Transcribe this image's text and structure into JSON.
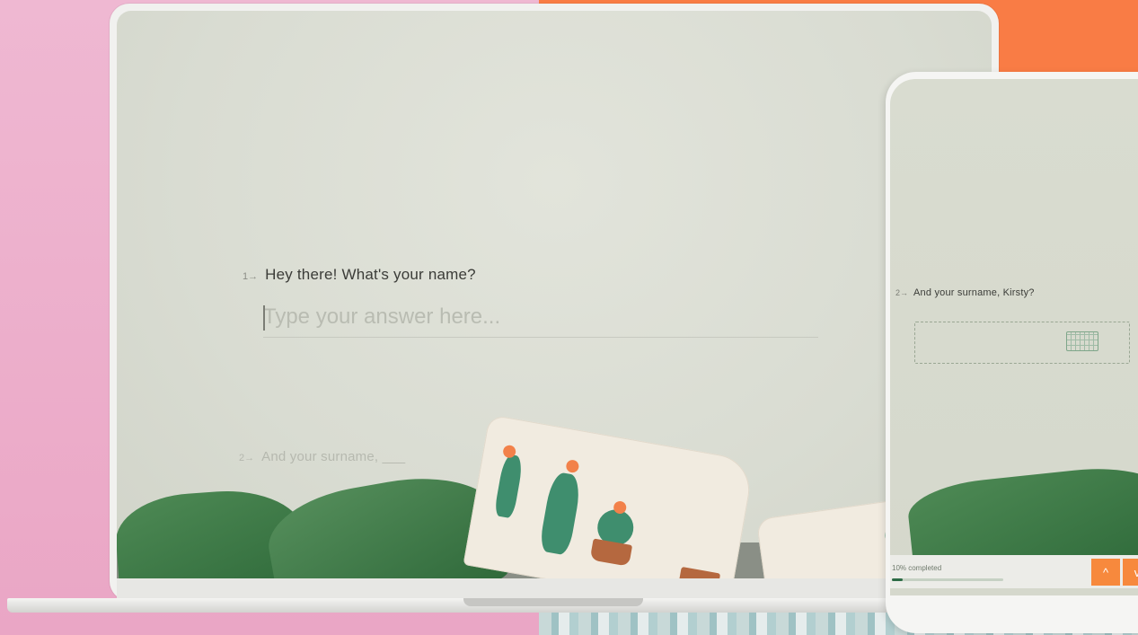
{
  "colors": {
    "accent": "#f7893d",
    "progress": "#2d6b46"
  },
  "laptop_form": {
    "question1": {
      "number": "1→",
      "text": "Hey there! What's your name?"
    },
    "answer_placeholder": "Type your answer here...",
    "question2": {
      "number": "2→",
      "text": "And your surname, ___"
    }
  },
  "phone_form": {
    "question": {
      "number": "2→",
      "text": "And your surname, Kirsty?"
    },
    "keyboard_icon": "keyboard-icon",
    "progress_label": "10% completed",
    "progress_value": 0.1,
    "nav": {
      "up_icon": "^",
      "down_icon": "v"
    }
  }
}
